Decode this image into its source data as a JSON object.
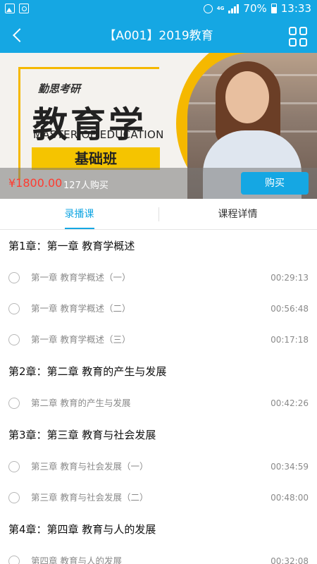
{
  "status_bar": {
    "network": "4G",
    "battery": "70%",
    "time": "13:33"
  },
  "header": {
    "title": "【A001】2019教育"
  },
  "banner": {
    "brand": "勤思考研",
    "title": "教育学",
    "subtitle": "MASTER OF EDUCATION",
    "class_name": "基础班",
    "price": "¥1800.00",
    "buyers": "127人购买",
    "buy_label": "购买"
  },
  "tabs": [
    {
      "label": "录播课",
      "active": true
    },
    {
      "label": "课程详情",
      "active": false
    }
  ],
  "chapters": [
    {
      "title": "第1章：第一章 教育学概述",
      "lessons": [
        {
          "name": "第一章 教育学概述（一）",
          "duration": "00:29:13"
        },
        {
          "name": "第一章 教育学概述（二）",
          "duration": "00:56:48"
        },
        {
          "name": "第一章 教育学概述（三）",
          "duration": "00:17:18"
        }
      ]
    },
    {
      "title": "第2章：第二章 教育的产生与发展",
      "lessons": [
        {
          "name": "第二章 教育的产生与发展",
          "duration": "00:42:26"
        }
      ]
    },
    {
      "title": "第3章：第三章 教育与社会发展",
      "lessons": [
        {
          "name": "第三章 教育与社会发展（一）",
          "duration": "00:34:59"
        },
        {
          "name": "第三章 教育与社会发展（二）",
          "duration": "00:48:00"
        }
      ]
    },
    {
      "title": "第4章：第四章 教育与人的发展",
      "lessons": [
        {
          "name": "第四章 教育与人的发展",
          "duration": "00:32:08"
        }
      ]
    }
  ],
  "colors": {
    "accent": "#15a7e3",
    "price": "#ff3b30",
    "banner_yellow": "#f5b800"
  }
}
